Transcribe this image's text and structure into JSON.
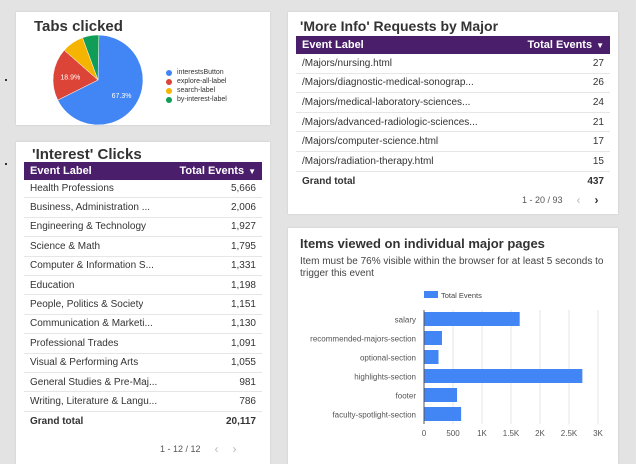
{
  "pie": {
    "title": "Tabs clicked",
    "slices": [
      {
        "label": "interestsButton",
        "pct": 67.3,
        "color": "#4285f4",
        "shown": "67.3%"
      },
      {
        "label": "explore-all-label",
        "pct": 18.9,
        "color": "#db4437",
        "shown": "18.9%"
      },
      {
        "label": "search-label",
        "pct": 7.9,
        "color": "#f4b400",
        "shown": ""
      },
      {
        "label": "by-interest-label",
        "pct": 5.9,
        "color": "#0f9d58",
        "shown": ""
      }
    ]
  },
  "interest": {
    "title": "'Interest' Clicks",
    "col_label": "Event Label",
    "col_value": "Total Events",
    "sort_icon": "▼",
    "rows": [
      {
        "label": "Health Professions",
        "value": "5,666"
      },
      {
        "label": "Business, Administration ...",
        "value": "2,006"
      },
      {
        "label": "Engineering & Technology",
        "value": "1,927"
      },
      {
        "label": "Science & Math",
        "value": "1,795"
      },
      {
        "label": "Computer & Information S...",
        "value": "1,331"
      },
      {
        "label": "Education",
        "value": "1,198"
      },
      {
        "label": "People, Politics & Society",
        "value": "1,151"
      },
      {
        "label": "Communication & Marketi...",
        "value": "1,130"
      },
      {
        "label": "Professional Trades",
        "value": "1,091"
      },
      {
        "label": "Visual & Performing Arts",
        "value": "1,055"
      },
      {
        "label": "General Studies & Pre-Maj...",
        "value": "981"
      },
      {
        "label": "Writing, Literature & Langu...",
        "value": "786"
      }
    ],
    "total_label": "Grand total",
    "total_value": "20,117",
    "pager": "1 - 12 / 12",
    "prev": "‹",
    "next": "›"
  },
  "moreinfo": {
    "title": "'More Info' Requests by Major",
    "col_label": "Event Label",
    "col_value": "Total Events",
    "sort_icon": "▼",
    "rows": [
      {
        "label": "/Majors/nursing.html",
        "value": "27"
      },
      {
        "label": "/Majors/diagnostic-medical-sonograp...",
        "value": "26"
      },
      {
        "label": "/Majors/medical-laboratory-sciences...",
        "value": "24"
      },
      {
        "label": "/Majors/advanced-radiologic-sciences...",
        "value": "21"
      },
      {
        "label": "/Majors/computer-science.html",
        "value": "17"
      },
      {
        "label": "/Majors/radiation-therapy.html",
        "value": "15"
      }
    ],
    "total_label": "Grand total",
    "total_value": "437",
    "pager": "1 - 20 / 93",
    "prev": "‹",
    "next": "›"
  },
  "items": {
    "title": "Items viewed on individual major pages",
    "subtitle": "Item must be 76% visible within the browser for at least 5 seconds to trigger this event"
  },
  "chart_data": {
    "type": "bar",
    "orientation": "horizontal",
    "categories": [
      "salary",
      "recommended-majors-section",
      "optional-section",
      "highlights-section",
      "footer",
      "faculty-spotlight-section"
    ],
    "series": [
      {
        "name": "Total Events",
        "values": [
          1650,
          310,
          250,
          2730,
          570,
          640
        ],
        "color": "#4285f4"
      }
    ],
    "xticks": [
      "0",
      "500",
      "1K",
      "1.5K",
      "2K",
      "2.5K",
      "3K"
    ],
    "xlim": [
      0,
      3000
    ],
    "legend": "top",
    "grid": true
  }
}
